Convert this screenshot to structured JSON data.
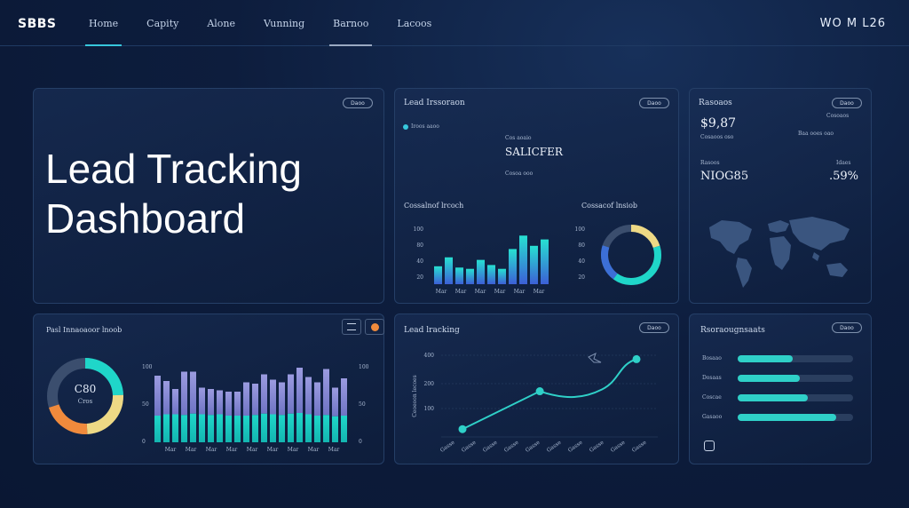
{
  "header": {
    "brand": "SBBS",
    "nav": [
      "Home",
      "Capity",
      "Alone",
      "Vunning",
      "Barnoo",
      "Lacoos"
    ],
    "user": "WO M L26"
  },
  "hero": {
    "title_line1": "Lead Tracking",
    "title_line2": "Dashboard",
    "pill": "Daoo"
  },
  "panel_tl": {
    "title": "Lead Irssoraon",
    "pill": "Daoo",
    "legend": "Iroos aaoo",
    "center_top": "Cos aoaio",
    "center_main": "SALICFER",
    "center_sub": "Cosoa ooo",
    "bars_title": "Cossalnof lrcoch",
    "donut_title": "Cossacof lnsiob",
    "y_ticks": [
      "100",
      "80",
      "40",
      "20"
    ],
    "x_ticks": [
      "Mar",
      "Mar",
      "Mar",
      "Mar",
      "Mar",
      "Mar"
    ],
    "bar_values": [
      28,
      42,
      26,
      24,
      38,
      30,
      24,
      55,
      76,
      60,
      70
    ],
    "donut_value": 80
  },
  "panel_tr": {
    "title": "Rasoaos",
    "pill": "Daoo",
    "stat1_value": "$9,87",
    "stat1_label": "Cosaoos oso",
    "stat1_side_top": "Cosoaos",
    "stat1_side_bottom": "Baa ooes oao",
    "stat2_label": "Rasoos",
    "stat2_value": "NIOG85",
    "stat2_side_label": "Idaes",
    "stat2_side_value": ".59%"
  },
  "panel_bl": {
    "title": "Pasl Innaoaoor lnoob",
    "donut_value_label": "C80",
    "donut_sub": "Cros",
    "donut_value": 70,
    "y_left": [
      "100",
      "50",
      "0"
    ],
    "y_right": [
      "100",
      "50",
      "0"
    ],
    "x_ticks": [
      "Mar",
      "Mar",
      "Mar",
      "Mar",
      "Mar",
      "Mar",
      "Mar",
      "Mar",
      "Mar"
    ],
    "bottom_values": [
      40,
      42,
      42,
      41,
      43,
      42,
      41,
      42,
      40,
      40,
      40,
      41,
      43,
      42,
      41,
      43,
      44,
      42,
      40,
      41,
      39,
      40
    ],
    "top_values": [
      100,
      92,
      80,
      106,
      106,
      82,
      80,
      78,
      76,
      76,
      90,
      88,
      102,
      94,
      90,
      102,
      112,
      98,
      90,
      110,
      82,
      96
    ]
  },
  "panel_bm": {
    "title": "Lead lracking",
    "pill": "Daoo",
    "y_ticks": [
      "100",
      "200",
      "400"
    ],
    "y_axis_label": "Ceoeoon lecoes",
    "x_ticks": [
      "Gasse",
      "Gasse",
      "Gasse",
      "Gasse",
      "Gasse",
      "Gasse",
      "Gasse",
      "Gasse",
      "Gasse",
      "Gasse"
    ],
    "points": [
      {
        "x": 0,
        "y": 40
      },
      {
        "x": 4,
        "y": 235
      },
      {
        "x": 9,
        "y": 400
      }
    ]
  },
  "panel_br": {
    "title": "Rsoraougnsaats",
    "pill": "Daoo",
    "rows": [
      {
        "label": "Bosaao",
        "value": 0.48
      },
      {
        "label": "Dosaas",
        "value": 0.54
      },
      {
        "label": "Coscae",
        "value": 0.61
      },
      {
        "label": "Gasaoo",
        "value": 0.85
      }
    ]
  },
  "colors": {
    "accent": "#37c7dc",
    "bar_teal": "#1fd6c9",
    "bar_purple": "#8f8ed8",
    "donut_orange": "#f08a3c",
    "donut_yellow": "#eed985"
  }
}
